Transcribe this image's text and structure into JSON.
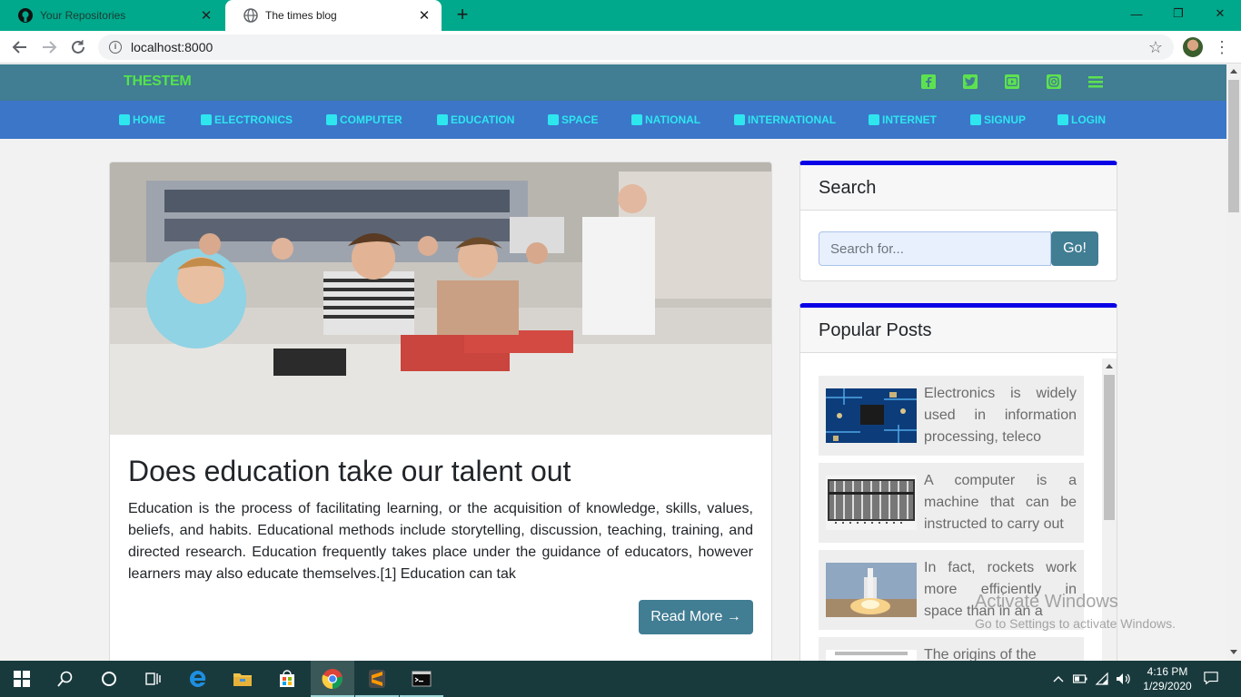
{
  "browser": {
    "tabs": [
      {
        "title": "Your Repositories",
        "active": false
      },
      {
        "title": "The times blog",
        "active": true
      }
    ],
    "url": "localhost:8000",
    "accent_color": "#00a98b"
  },
  "site": {
    "brand": "THESTEM",
    "social_icons": [
      "facebook-icon",
      "twitter-icon",
      "youtube-icon",
      "instagram-icon",
      "menu-icon"
    ],
    "nav": [
      {
        "label": "HOME",
        "icon": "home-icon"
      },
      {
        "label": "ELECTRONICS",
        "icon": "chip-icon"
      },
      {
        "label": "COMPUTER",
        "icon": "laptop-icon"
      },
      {
        "label": "EDUCATION",
        "icon": "graduation-icon"
      },
      {
        "label": "SPACE",
        "icon": "gear-icon"
      },
      {
        "label": "NATIONAL",
        "icon": "flag-icon"
      },
      {
        "label": "INTERNATIONAL",
        "icon": "globe-icon"
      },
      {
        "label": "INTERNET",
        "icon": "internet-icon"
      },
      {
        "label": "SIGNUP",
        "icon": "user-icon"
      },
      {
        "label": "LOGIN",
        "icon": "login-icon"
      }
    ],
    "colors": {
      "topbar": "#417d93",
      "navbar": "#3b76c9",
      "nav_text": "#2ee6ee",
      "brand": "#53e34c",
      "widget_border": "#0a00e6"
    }
  },
  "article": {
    "title": "Does education take our talent out",
    "body": "Education is the process of facilitating learning, or the acquisition of knowledge, skills, values, beliefs, and habits. Educational methods include storytelling, discussion, teaching, training, and directed research. Education frequently takes place under the guidance of educators, however learners may also educate themselves.[1] Education can tak",
    "read_more": "Read More →"
  },
  "sidebar": {
    "search": {
      "title": "Search",
      "placeholder": "Search for...",
      "button": "Go!"
    },
    "popular": {
      "title": "Popular Posts",
      "items": [
        {
          "text": "Electronics is widely used in information processing, teleco",
          "thumb": "circuit-board-image"
        },
        {
          "text": "A computer is a machine that can be instructed to carry out",
          "thumb": "abacus-image"
        },
        {
          "text": "In fact, rockets work more efficiently in space than in an a",
          "thumb": "rocket-launch-image"
        },
        {
          "text": "The origins of the",
          "thumb": "network-diagram-image"
        }
      ]
    }
  },
  "watermark": {
    "line1": "Activate Windows",
    "line2": "Go to Settings to activate Windows."
  },
  "taskbar": {
    "time": "4:16 PM",
    "date": "1/29/2020"
  }
}
